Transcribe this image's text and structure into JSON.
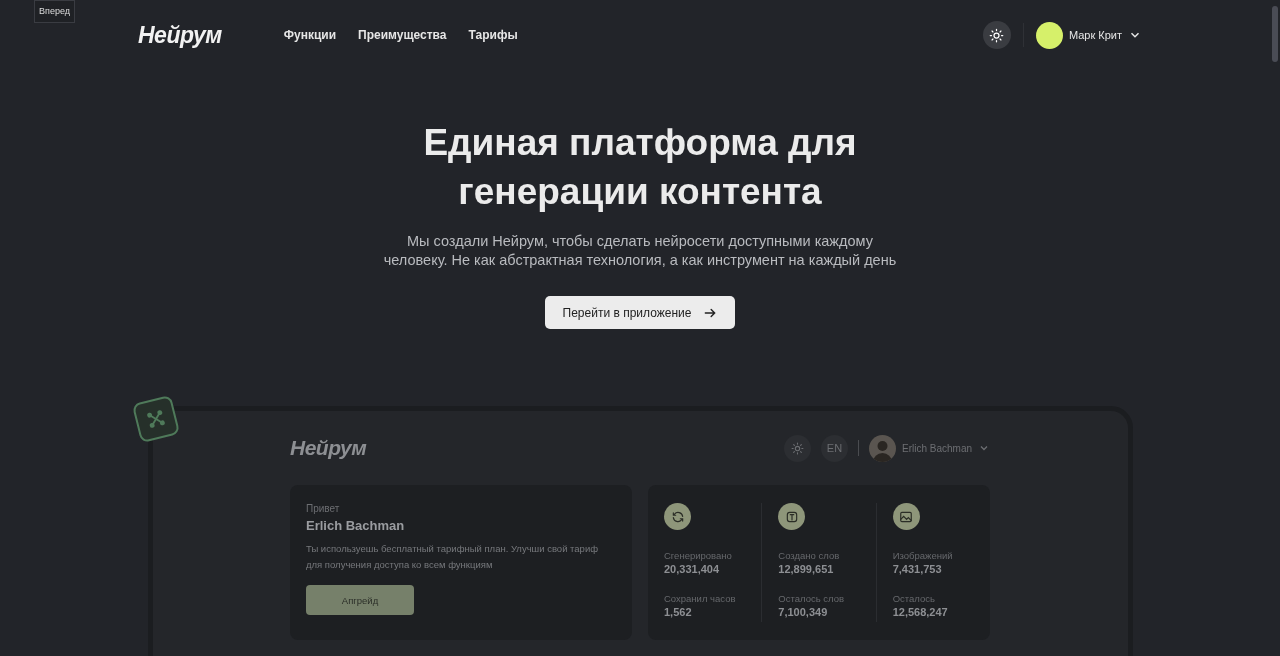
{
  "tooltip": "Вперед",
  "header": {
    "logo": "Нейрум",
    "nav": [
      "Функции",
      "Преимущества",
      "Тарифы"
    ],
    "user": "Марк Крит"
  },
  "hero": {
    "title_lines": [
      "Единая платформа для",
      "генерации контента"
    ],
    "subtitle": "Мы создали Нейрум, чтобы сделать нейросети доступными каждому человеку. Не как абстрактная технология, а как инструмент на каждый день",
    "cta": "Перейти в приложение"
  },
  "preview": {
    "logo": "Нейрум",
    "lang": "EN",
    "user": "Erlich Bachman",
    "greeting": {
      "hello": "Привет",
      "name": "Erlich Bachman",
      "text": "Ты используешь бесплатный тарифный план. Улучши свой тариф для получения доступа ко всем функциям",
      "button": "Апгрейд"
    },
    "stats": [
      {
        "kind": "refresh",
        "items": [
          {
            "label": "Сгенерировано",
            "value": "20,331,404"
          },
          {
            "label": "Сохранил часов",
            "value": "1,562"
          }
        ]
      },
      {
        "kind": "text",
        "items": [
          {
            "label": "Создано слов",
            "value": "12,899,651"
          },
          {
            "label": "Осталось слов",
            "value": "7,100,349"
          }
        ]
      },
      {
        "kind": "image",
        "items": [
          {
            "label": "Изображений",
            "value": "7,431,753"
          },
          {
            "label": "Осталось",
            "value": "12,568,247"
          }
        ]
      }
    ]
  }
}
